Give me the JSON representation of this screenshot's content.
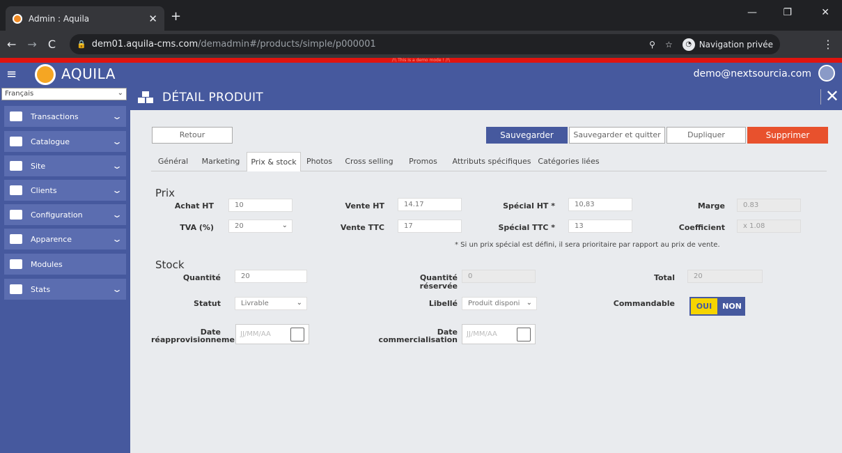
{
  "browser": {
    "tab_title": "Admin : Aquila",
    "url_host": "dem01.aquila-cms.com",
    "url_path": "/demadmin#/products/simple/p000001",
    "incognito_label": "Navigation privée"
  },
  "demo_banner": "/!\\ This is a demo mode ! /!\\",
  "header": {
    "brand": "AQUILA",
    "user_email": "demo@nextsourcia.com"
  },
  "sidebar": {
    "language": "Français",
    "items": [
      {
        "label": "Transactions",
        "icon": "handshake-icon"
      },
      {
        "label": "Catalogue",
        "icon": "database-icon"
      },
      {
        "label": "Site",
        "icon": "monitor-icon"
      },
      {
        "label": "Clients",
        "icon": "users-icon"
      },
      {
        "label": "Configuration",
        "icon": "wrench-icon"
      },
      {
        "label": "Apparence",
        "icon": "monitor-icon"
      },
      {
        "label": "Modules",
        "icon": "rocket-icon"
      },
      {
        "label": "Stats",
        "icon": "bar-chart-icon"
      }
    ]
  },
  "page": {
    "title": "DÉTAIL PRODUIT"
  },
  "actions": {
    "back": "Retour",
    "save": "Sauvegarder",
    "save_quit": "Sauvegarder et quitter",
    "duplicate": "Dupliquer",
    "delete": "Supprimer"
  },
  "tabs": [
    "Général",
    "Marketing",
    "Prix & stock",
    "Photos",
    "Cross selling",
    "Promos",
    "Attributs spécifiques",
    "Catégories liées"
  ],
  "active_tab": "Prix & stock",
  "prix": {
    "heading": "Prix",
    "achat_ht_label": "Achat HT",
    "achat_ht": "10",
    "vente_ht_label": "Vente HT",
    "vente_ht": "14.17",
    "special_ht_label": "Spécial HT *",
    "special_ht": "10,83",
    "marge_label": "Marge",
    "marge": "0.83",
    "tva_label": "TVA (%)",
    "tva": "20",
    "vente_ttc_label": "Vente TTC",
    "vente_ttc": "17",
    "special_ttc_label": "Spécial TTC *",
    "special_ttc": "13",
    "coefficient_label": "Coefficient",
    "coefficient": "x 1.08",
    "note": "* Si un prix spécial est défini, il sera prioritaire par rapport au prix de vente."
  },
  "stock": {
    "heading": "Stock",
    "quantite_label": "Quantité",
    "quantite": "20",
    "reservee_label_1": "Quantité",
    "reservee_label_2": "réservée",
    "reservee": "0",
    "total_label": "Total",
    "total": "20",
    "statut_label": "Statut",
    "statut": "Livrable",
    "libelle_label": "Libellé",
    "libelle": "Produit disponi",
    "commandable_label": "Commandable",
    "oui": "OUI",
    "non": "NON",
    "date_reappro_label_1": "Date",
    "date_reappro_label_2": "réapprovisionneme",
    "date_comm_label_1": "Date",
    "date_comm_label_2": "commercialisation",
    "date_placeholder": "JJ/MM/AA"
  },
  "colors": {
    "primary": "#46599e",
    "danger": "#e8512d",
    "toggle_on": "#f6d400"
  }
}
